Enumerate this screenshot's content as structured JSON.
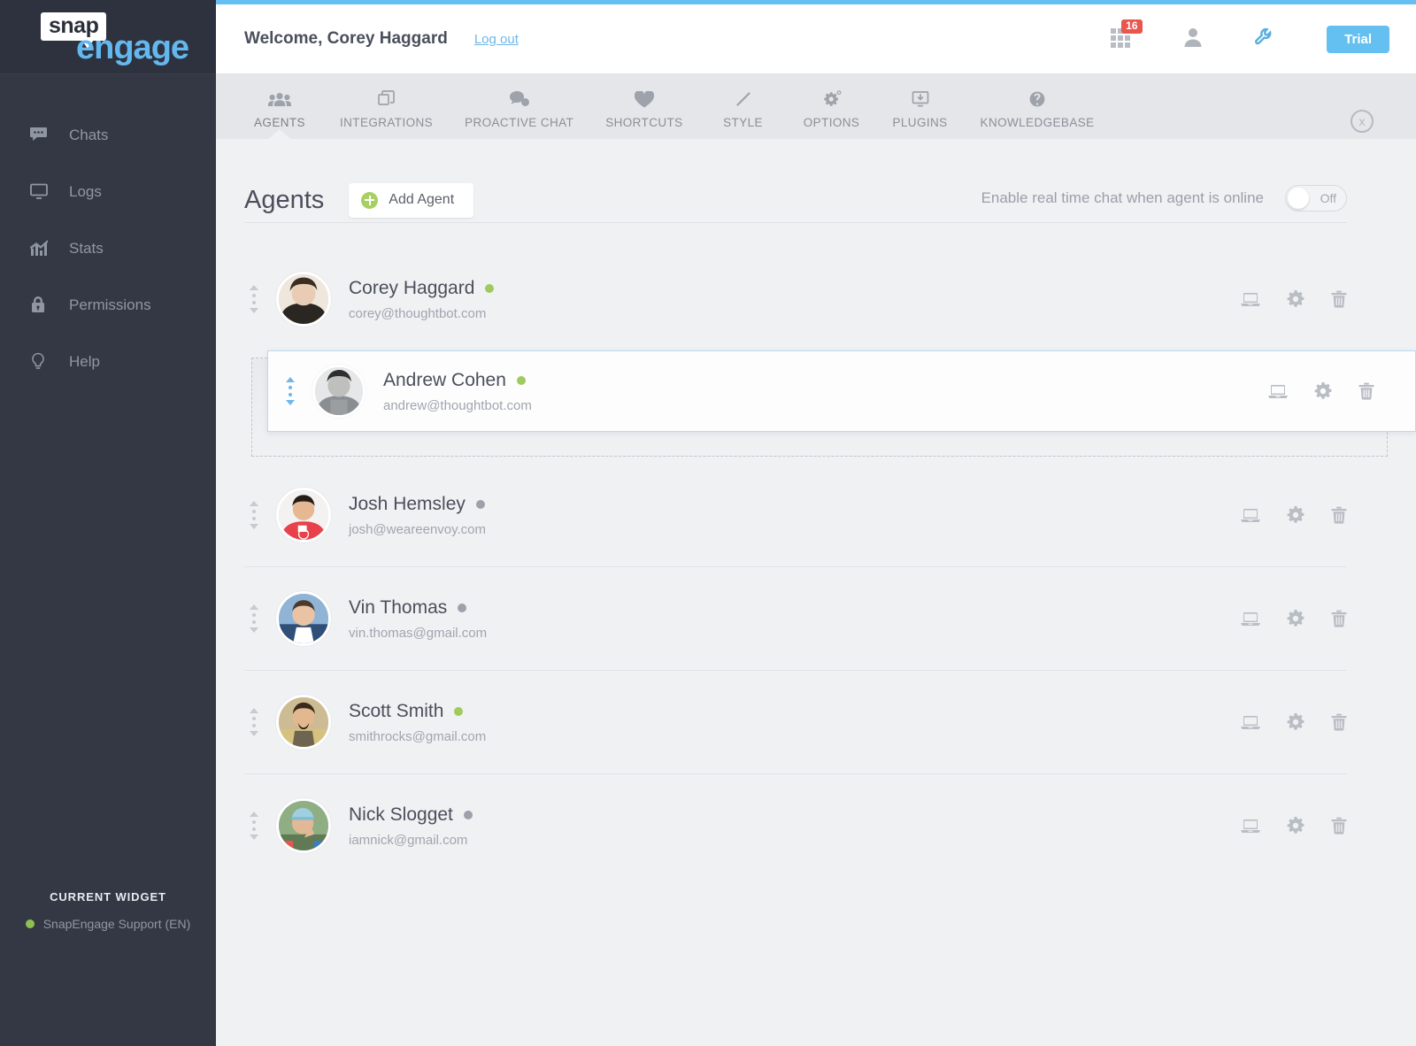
{
  "brand": {
    "logo_word_1": "snap",
    "logo_word_2": "engage",
    "accent_blue": "#63c0f0",
    "sidebar_bg": "#343845",
    "online_green": "#9fca5e",
    "badge_red": "#e8564e"
  },
  "sidebar": {
    "items": [
      {
        "label": "Chats",
        "icon": "chat-bubble-icon"
      },
      {
        "label": "Logs",
        "icon": "monitor-icon"
      },
      {
        "label": "Stats",
        "icon": "bar-chart-icon"
      },
      {
        "label": "Permissions",
        "icon": "lock-icon"
      },
      {
        "label": "Help",
        "icon": "lightbulb-icon"
      }
    ],
    "current_widget_title": "CURRENT WIDGET",
    "current_widget_name": "SnapEngage Support (EN)",
    "current_widget_status": "online"
  },
  "topbar": {
    "welcome": "Welcome, Corey Haggard",
    "logout": "Log out",
    "apps_badge_count": "16",
    "apps_icon": "grid-apps-icon",
    "account_icon": "user-icon",
    "settings_icon": "wrench-icon",
    "trial_label": "Trial"
  },
  "tabs": [
    {
      "label": "AGENTS",
      "icon": "people-icon",
      "active": true
    },
    {
      "label": "INTEGRATIONS",
      "icon": "copy-squares-icon",
      "active": false
    },
    {
      "label": "PROACTIVE CHAT",
      "icon": "speech-bubbles-icon",
      "active": false
    },
    {
      "label": "SHORTCUTS",
      "icon": "heart-icon",
      "active": false
    },
    {
      "label": "STYLE",
      "icon": "pencil-icon",
      "active": false
    },
    {
      "label": "OPTIONS",
      "icon": "gear-icon",
      "active": false
    },
    {
      "label": "PLUGINS",
      "icon": "monitor-download-icon",
      "active": false
    },
    {
      "label": "KNOWLEDGEBASE",
      "icon": "question-circle-icon",
      "active": false
    }
  ],
  "tabbar": {
    "close_icon": "close-circle-icon",
    "close_label": "x"
  },
  "page": {
    "title": "Agents",
    "add_agent_label": "Add Agent",
    "realtime_label": "Enable real time chat when agent is online",
    "realtime_state": "Off"
  },
  "row_actions": [
    {
      "icon": "laptop-icon"
    },
    {
      "icon": "gear-icon"
    },
    {
      "icon": "trash-icon"
    }
  ],
  "agents": [
    {
      "name": "Corey Haggard",
      "email": "corey@thoughtbot.com",
      "status": "online",
      "dragging": false
    },
    {
      "name": "Andrew Cohen",
      "email": "andrew@thoughtbot.com",
      "status": "online",
      "dragging": true
    },
    {
      "name": "Josh Hemsley",
      "email": "josh@weareenvoy.com",
      "status": "offline",
      "dragging": false
    },
    {
      "name": "Vin Thomas",
      "email": "vin.thomas@gmail.com",
      "status": "offline",
      "dragging": false
    },
    {
      "name": "Scott Smith",
      "email": "smithrocks@gmail.com",
      "status": "online",
      "dragging": false
    },
    {
      "name": "Nick Slogget",
      "email": "iamnick@gmail.com",
      "status": "offline",
      "dragging": false
    }
  ]
}
